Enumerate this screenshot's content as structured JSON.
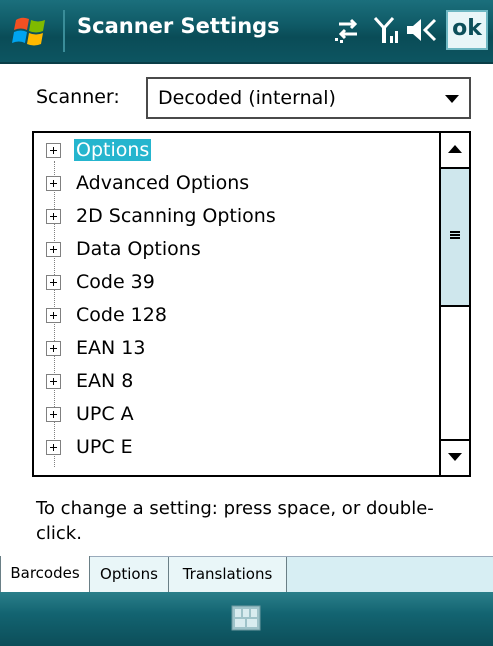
{
  "title_bar": {
    "title": "Scanner Settings",
    "ok_label": "ok",
    "icons": [
      "windows-start-icon",
      "connectivity-icon",
      "signal-icon",
      "volume-icon"
    ]
  },
  "scanner": {
    "label": "Scanner:",
    "selected_value": "Decoded (internal)"
  },
  "tree": {
    "items": [
      {
        "label": "Options",
        "selected": true
      },
      {
        "label": "Advanced Options"
      },
      {
        "label": "2D Scanning Options"
      },
      {
        "label": "Data Options"
      },
      {
        "label": "Code 39"
      },
      {
        "label": "Code 128"
      },
      {
        "label": "EAN 13"
      },
      {
        "label": "EAN 8"
      },
      {
        "label": "UPC A"
      },
      {
        "label": "UPC E"
      }
    ],
    "selection_color": "#25b5ce"
  },
  "hint": {
    "text": "To change a setting: press space, or double-click."
  },
  "tabs": [
    {
      "label": "Barcodes",
      "active": true
    },
    {
      "label": "Options"
    },
    {
      "label": "Translations"
    }
  ],
  "bottom_bar": {
    "icons": [
      "keyboard-icon"
    ]
  },
  "colors": {
    "title_bar": "#0f5a66",
    "tab_strip": "#d7eef3",
    "scroll_thumb": "#cfe7ed"
  }
}
